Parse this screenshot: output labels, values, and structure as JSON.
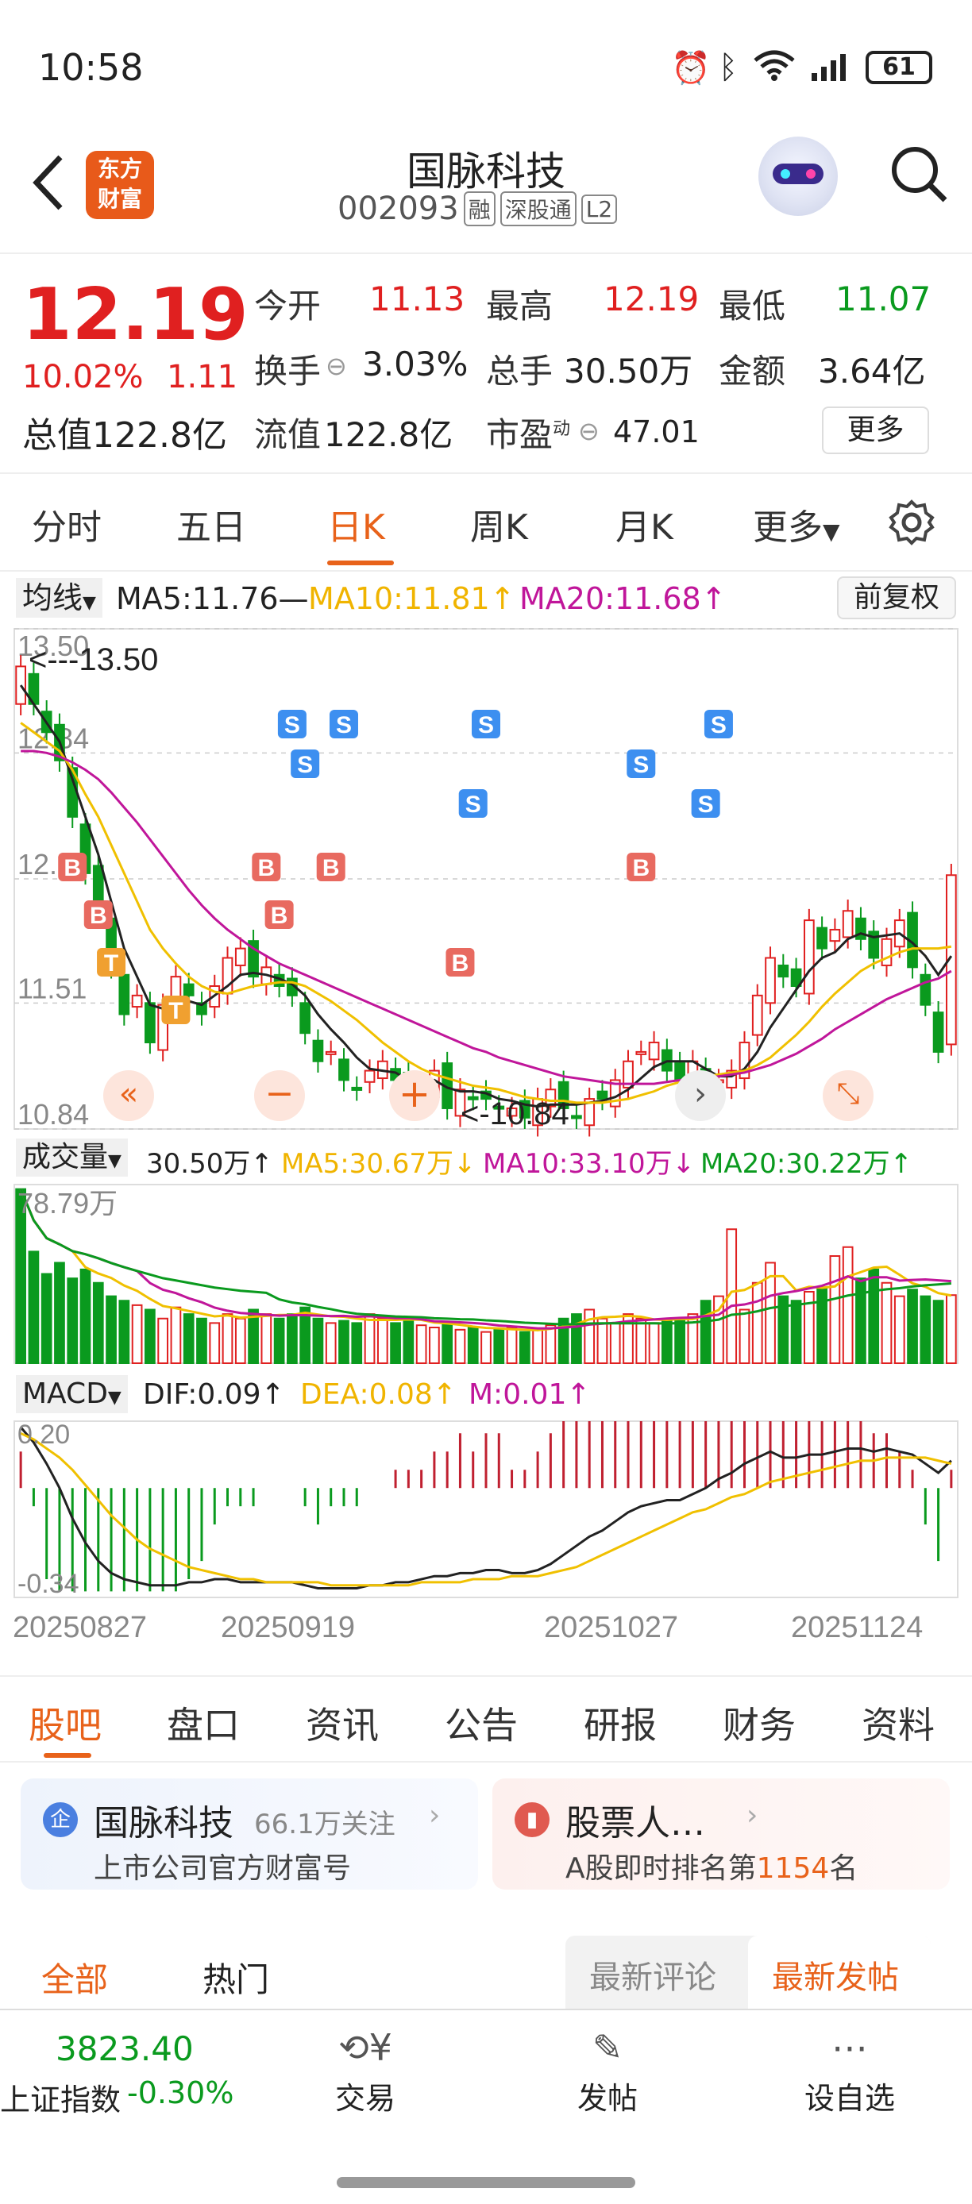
{
  "status": {
    "time": "10:58",
    "battery": "61"
  },
  "header": {
    "logo_line1": "东方",
    "logo_line2": "财富",
    "title": "国脉科技",
    "code": "002093",
    "badges": [
      "融",
      "深股通",
      "L2"
    ]
  },
  "quote": {
    "price": "12.19",
    "change_pct": "10.02%",
    "change_amt": "1.11",
    "total_value_label": "总值",
    "total_value": "122.8亿",
    "stats": [
      {
        "label": "今开",
        "value": "11.13",
        "color": "red"
      },
      {
        "label": "最高",
        "value": "12.19",
        "color": "red"
      },
      {
        "label": "最低",
        "value": "11.07",
        "color": "green"
      },
      {
        "label": "换手",
        "value": "3.03%",
        "color": "black"
      },
      {
        "label": "总手",
        "value": "30.50万",
        "color": "black"
      },
      {
        "label": "金额",
        "value": "3.64亿",
        "color": "black"
      },
      {
        "label": "流值",
        "value": "122.8亿",
        "color": "black"
      },
      {
        "label": "市盈",
        "sup": "动",
        "value": "47.01",
        "color": "black"
      }
    ],
    "more_button": "更多"
  },
  "period_tabs": [
    "分时",
    "五日",
    "日K",
    "周K",
    "月K",
    "更多"
  ],
  "active_period": 2,
  "indicators": {
    "ma_selector": "均线",
    "ma5": "MA5:11.76—",
    "ma10": "MA10:11.81↑",
    "ma20": "MA20:11.68↑",
    "adjust_button": "前复权",
    "vol_selector": "成交量",
    "vol": "30.50万↑",
    "vol_ma5": "MA5:30.67万↓",
    "vol_ma10": "MA10:33.10万↓",
    "vol_ma20": "MA20:30.22万↑",
    "macd_selector": "MACD",
    "dif": "DIF:0.09↑",
    "dea": "DEA:0.08↑",
    "m": "M:0.01↑"
  },
  "chart_data": {
    "type": "candlestick",
    "y_axis_labels": [
      "13.50",
      "12.84",
      "12.17",
      "11.51",
      "10.84"
    ],
    "high_marker": "<---13.50",
    "low_marker": "<-10.84",
    "ylim": [
      10.84,
      13.5
    ],
    "volume_max_label": "78.79万",
    "macd_labels": [
      "0.20",
      "-0.34"
    ],
    "dates": [
      "20250827",
      "20250919",
      "20251027",
      "20251124"
    ],
    "closes": [
      13.3,
      13.1,
      12.95,
      12.8,
      12.5,
      12.2,
      12.0,
      11.7,
      11.45,
      11.55,
      11.3,
      11.5,
      11.65,
      11.55,
      11.45,
      11.6,
      11.75,
      11.8,
      11.65,
      11.7,
      11.6,
      11.55,
      11.35,
      11.2,
      11.25,
      11.1,
      11.05,
      11.15,
      11.2,
      11.1,
      11.0,
      11.05,
      11.15,
      10.95,
      11.05,
      11.0,
      11.0,
      10.95,
      10.95,
      10.9,
      11.0,
      11.05,
      10.95,
      10.9,
      11.0,
      11.0,
      11.1,
      11.2,
      11.25,
      11.3,
      11.15,
      11.1,
      11.2,
      11.05,
      11.1,
      11.15,
      11.3,
      11.55,
      11.75,
      11.65,
      11.6,
      11.95,
      11.8,
      11.9,
      12.0,
      11.85,
      11.75,
      11.85,
      11.95,
      11.7,
      11.5,
      11.25,
      12.19
    ],
    "ma5": [
      13.2,
      13.1,
      13.0,
      12.9,
      12.7,
      12.5,
      12.3,
      12.05,
      11.8,
      11.65,
      11.5,
      11.48,
      11.5,
      11.52,
      11.5,
      11.55,
      11.6,
      11.66,
      11.67,
      11.66,
      11.64,
      11.61,
      11.55,
      11.45,
      11.37,
      11.3,
      11.22,
      11.16,
      11.15,
      11.14,
      11.1,
      11.08,
      11.1,
      11.06,
      11.04,
      11.04,
      11.03,
      11.0,
      10.99,
      10.97,
      10.96,
      10.97,
      10.97,
      10.97,
      10.98,
      10.99,
      11.01,
      11.05,
      11.11,
      11.17,
      11.2,
      11.2,
      11.2,
      11.16,
      11.12,
      11.12,
      11.16,
      11.25,
      11.38,
      11.48,
      11.58,
      11.68,
      11.75,
      11.78,
      11.85,
      11.88,
      11.86,
      11.87,
      11.88,
      11.83,
      11.76,
      11.66,
      11.76
    ],
    "ma10": [
      13.0,
      12.95,
      12.9,
      12.85,
      12.75,
      12.62,
      12.5,
      12.35,
      12.2,
      12.05,
      11.9,
      11.8,
      11.72,
      11.65,
      11.6,
      11.57,
      11.56,
      11.58,
      11.6,
      11.61,
      11.62,
      11.62,
      11.6,
      11.56,
      11.52,
      11.47,
      11.42,
      11.36,
      11.3,
      11.25,
      11.2,
      11.16,
      11.13,
      11.11,
      11.09,
      11.07,
      11.06,
      11.05,
      11.03,
      11.01,
      11.0,
      10.99,
      10.99,
      10.98,
      10.98,
      10.98,
      10.99,
      11.0,
      11.02,
      11.04,
      11.07,
      11.09,
      11.11,
      11.12,
      11.13,
      11.14,
      11.15,
      11.18,
      11.22,
      11.28,
      11.34,
      11.41,
      11.49,
      11.56,
      11.62,
      11.68,
      11.72,
      11.75,
      11.78,
      11.8,
      11.8,
      11.8,
      11.81
    ],
    "ma20": [
      12.85,
      12.85,
      12.84,
      12.82,
      12.79,
      12.75,
      12.7,
      12.63,
      12.55,
      12.47,
      12.38,
      12.29,
      12.2,
      12.11,
      12.03,
      11.96,
      11.9,
      11.85,
      11.8,
      11.76,
      11.72,
      11.69,
      11.66,
      11.63,
      11.6,
      11.57,
      11.54,
      11.51,
      11.48,
      11.45,
      11.42,
      11.39,
      11.36,
      11.33,
      11.3,
      11.27,
      11.25,
      11.22,
      11.2,
      11.18,
      11.16,
      11.14,
      11.12,
      11.11,
      11.1,
      11.09,
      11.08,
      11.08,
      11.08,
      11.08,
      11.09,
      11.1,
      11.1,
      11.11,
      11.12,
      11.13,
      11.14,
      11.16,
      11.18,
      11.21,
      11.24,
      11.28,
      11.32,
      11.37,
      11.41,
      11.45,
      11.49,
      11.53,
      11.56,
      11.59,
      11.62,
      11.64,
      11.68
    ],
    "volumes": [
      78,
      50,
      40,
      45,
      38,
      42,
      36,
      30,
      28,
      26,
      24,
      20,
      25,
      22,
      20,
      18,
      22,
      20,
      24,
      22,
      20,
      22,
      25,
      20,
      18,
      19,
      18,
      22,
      20,
      18,
      20,
      17,
      16,
      18,
      15,
      16,
      14,
      15,
      16,
      14,
      15,
      17,
      20,
      22,
      24,
      20,
      18,
      22,
      20,
      18,
      19,
      20,
      22,
      28,
      30,
      60,
      24,
      36,
      45,
      30,
      28,
      32,
      34,
      48,
      52,
      38,
      42,
      36,
      30,
      33,
      30,
      28,
      30.5
    ],
    "dif": [
      0.2,
      0.15,
      0.08,
      0.0,
      -0.1,
      -0.18,
      -0.24,
      -0.28,
      -0.3,
      -0.31,
      -0.32,
      -0.32,
      -0.32,
      -0.31,
      -0.31,
      -0.3,
      -0.3,
      -0.31,
      -0.31,
      -0.31,
      -0.31,
      -0.31,
      -0.32,
      -0.33,
      -0.33,
      -0.33,
      -0.33,
      -0.32,
      -0.32,
      -0.31,
      -0.31,
      -0.3,
      -0.29,
      -0.29,
      -0.28,
      -0.28,
      -0.27,
      -0.27,
      -0.28,
      -0.28,
      -0.27,
      -0.25,
      -0.22,
      -0.19,
      -0.16,
      -0.14,
      -0.11,
      -0.08,
      -0.06,
      -0.05,
      -0.04,
      -0.04,
      -0.02,
      0.0,
      0.03,
      0.05,
      0.08,
      0.1,
      0.12,
      0.1,
      0.1,
      0.11,
      0.11,
      0.12,
      0.13,
      0.13,
      0.12,
      0.13,
      0.12,
      0.11,
      0.08,
      0.05,
      0.09
    ],
    "dea": [
      0.18,
      0.16,
      0.13,
      0.1,
      0.06,
      0.01,
      -0.04,
      -0.09,
      -0.13,
      -0.17,
      -0.2,
      -0.22,
      -0.24,
      -0.26,
      -0.27,
      -0.28,
      -0.29,
      -0.3,
      -0.3,
      -0.31,
      -0.31,
      -0.31,
      -0.31,
      -0.31,
      -0.32,
      -0.32,
      -0.32,
      -0.32,
      -0.32,
      -0.32,
      -0.32,
      -0.31,
      -0.31,
      -0.31,
      -0.31,
      -0.3,
      -0.3,
      -0.3,
      -0.29,
      -0.29,
      -0.29,
      -0.28,
      -0.27,
      -0.26,
      -0.24,
      -0.22,
      -0.2,
      -0.18,
      -0.16,
      -0.14,
      -0.12,
      -0.1,
      -0.08,
      -0.07,
      -0.05,
      -0.03,
      -0.02,
      0.0,
      0.02,
      0.03,
      0.04,
      0.05,
      0.06,
      0.07,
      0.08,
      0.09,
      0.09,
      0.1,
      0.1,
      0.1,
      0.1,
      0.09,
      0.08
    ]
  },
  "low_tabs": [
    "股吧",
    "盘口",
    "资讯",
    "公告",
    "研报",
    "财务",
    "资料"
  ],
  "cards": {
    "left_title": "国脉科技",
    "left_follow": "66.1万关注",
    "left_sub": "上市公司官方财富号",
    "right_title": "股票人…",
    "right_sub_pre": "A股即时排名第",
    "right_rank": "1154",
    "right_sub_post": "名"
  },
  "feed_tabs": {
    "all": "全部",
    "hot": "热门",
    "latest_comment": "最新评论",
    "latest_post": "最新发帖"
  },
  "bottom": {
    "index_value": "3823.40",
    "index_name": "上证指数",
    "index_change": "-0.30%",
    "trade": "交易",
    "post": "发帖",
    "watch": "设自选"
  }
}
